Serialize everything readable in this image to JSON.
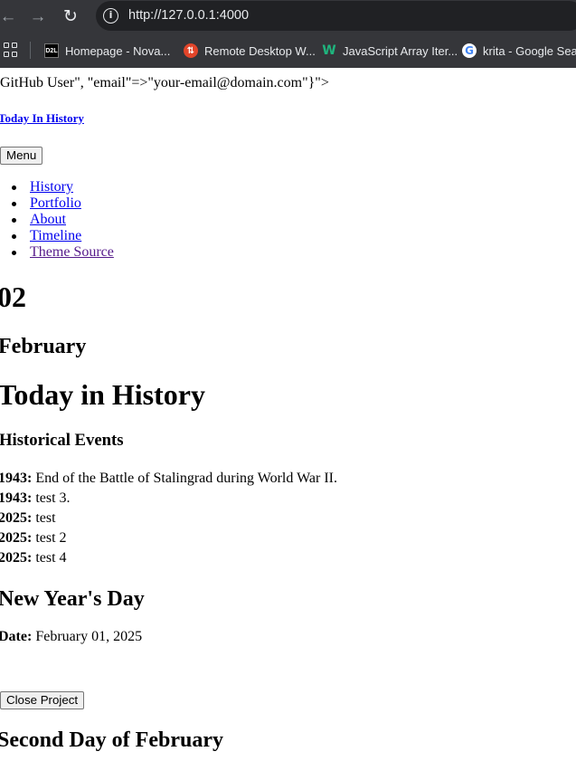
{
  "browser": {
    "url": "http://127.0.0.1:4000",
    "bookmarks": [
      {
        "label": "Homepage - Nova...",
        "icon": "d2l-icon"
      },
      {
        "label": "Remote Desktop W...",
        "icon": "remote-desktop-icon"
      },
      {
        "label": "JavaScript Array Iter...",
        "icon": "w3schools-icon"
      },
      {
        "label": "krita - Google Search",
        "icon": "google-icon"
      }
    ]
  },
  "page": {
    "stray_text": "GitHub User\", \"email\"=>\"your-email@domain.com\"}\">",
    "site_title": "Today In History",
    "menu_button": "Menu",
    "nav": [
      "History",
      "Portfolio",
      "About",
      "Timeline",
      "Theme Source"
    ],
    "day": "02",
    "month": "February",
    "title": "Today in History",
    "events_heading": "Historical Events",
    "events": [
      {
        "year": "1943:",
        "text": " End of the Battle of Stalingrad during World War II."
      },
      {
        "year": "1943:",
        "text": " test 3."
      },
      {
        "year": "2025:",
        "text": " test"
      },
      {
        "year": "2025:",
        "text": " test 2"
      },
      {
        "year": "2025:",
        "text": " test 4"
      }
    ],
    "project": {
      "title": "New Year's Day",
      "date_label": "Date:",
      "date_value": " February 01, 2025",
      "close_button": "Close Project"
    },
    "next_heading": "Second Day of February"
  },
  "colors": {
    "link": "#0000ee",
    "visited_link": "#551a8b",
    "chrome_bg": "#35363a",
    "omnibox_bg": "#202124"
  }
}
